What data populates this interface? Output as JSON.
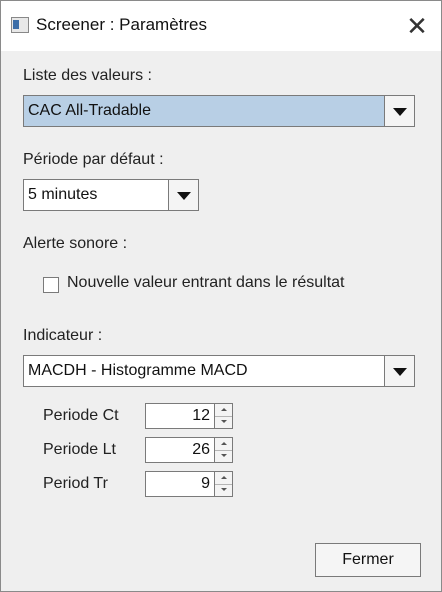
{
  "window": {
    "title": "Screener : Paramètres",
    "close_glyph": "✕"
  },
  "liste": {
    "label": "Liste des valeurs :",
    "value": "CAC All-Tradable"
  },
  "periode": {
    "label": "Période par défaut :",
    "value": "5 minutes"
  },
  "alerte": {
    "label": "Alerte sonore :",
    "checkbox_label": "Nouvelle valeur entrant dans le résultat",
    "checked": false
  },
  "indicateur": {
    "label": "Indicateur :",
    "value": "MACDH - Histogramme MACD",
    "params": [
      {
        "label": "Periode Ct",
        "value": "12"
      },
      {
        "label": "Periode Lt",
        "value": "26"
      },
      {
        "label": "Period Tr",
        "value": "9"
      }
    ]
  },
  "buttons": {
    "close": "Fermer"
  },
  "icons": [
    "app-icon",
    "close-icon",
    "chevron-down-icon",
    "spinner-up-icon",
    "spinner-down-icon"
  ]
}
